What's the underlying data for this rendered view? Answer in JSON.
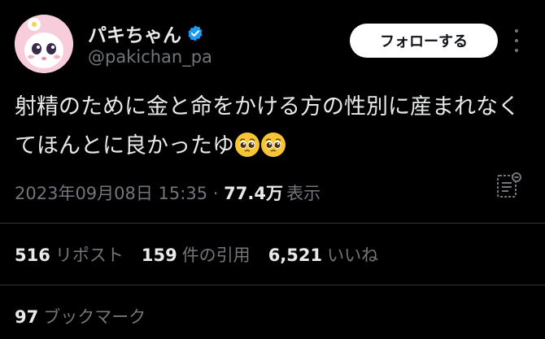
{
  "user": {
    "display_name": "パキちゃん",
    "handle": "@pakichan_pa",
    "verified": true
  },
  "actions": {
    "follow_label": "フォローする"
  },
  "tweet": {
    "text": "射精のために金と命をかける方の性別に産まれなくてほんとに良かったゆ",
    "emojis": [
      "pleading-face",
      "pleading-face"
    ]
  },
  "meta": {
    "timestamp": "2023年09月08日 15:35",
    "separator": " · ",
    "views_count": "77.4万",
    "views_label": "表示"
  },
  "stats": {
    "reposts_count": "516",
    "reposts_label": "リポスト",
    "quotes_count": "159",
    "quotes_label": "件の引用",
    "likes_count": "6,521",
    "likes_label": "いいね",
    "bookmarks_count": "97",
    "bookmarks_label": "ブックマーク"
  },
  "colors": {
    "background": "#000000",
    "text": "#e7e9ea",
    "muted": "#71767b",
    "verified": "#1d9bf0",
    "divider": "#2f3336"
  }
}
